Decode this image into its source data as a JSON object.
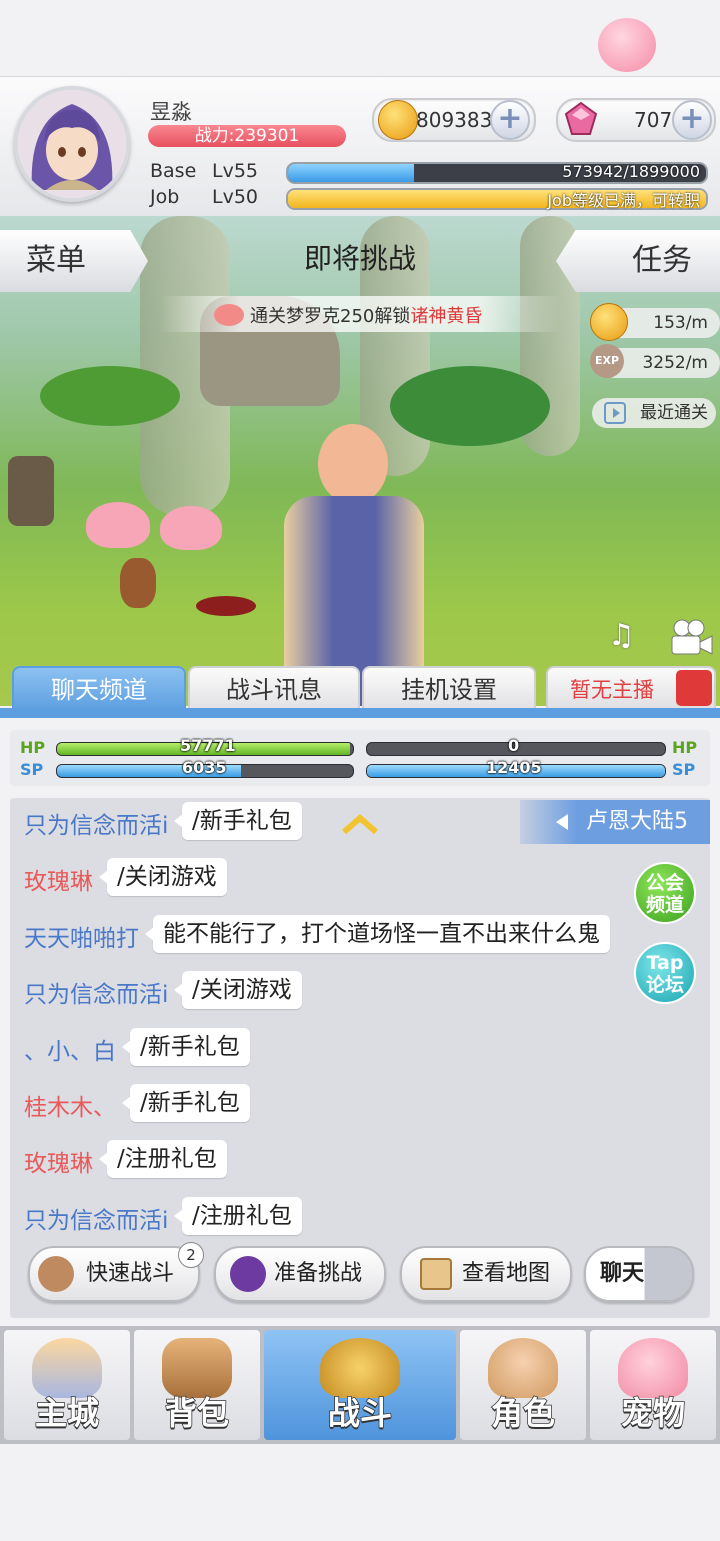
{
  "player": {
    "name": "昱淼",
    "power": "战力:239301"
  },
  "currency": {
    "coins": "809383",
    "gems": "707"
  },
  "levels": {
    "base_label": "Base",
    "base_level": "Lv55",
    "base_exp": "573942/1899000",
    "base_progress": 0.302,
    "job_label": "Job",
    "job_level": "Lv50",
    "job_status": "Job等级已满，可转职",
    "job_progress": 1.0
  },
  "scene": {
    "menu_label": "菜单",
    "task_label": "任务",
    "headline": "即将挑战",
    "unlock_prefix": "通关梦罗克250解锁",
    "unlock_highlight": "诸神黄昏",
    "coin_rate": "153/m",
    "exp_rate": "3252/m",
    "exp_icon": "EXP",
    "recent_clear": "最近通关"
  },
  "tabs": [
    {
      "label": "聊天频道",
      "active": true
    },
    {
      "label": "战斗讯息",
      "active": false
    },
    {
      "label": "挂机设置",
      "active": false
    }
  ],
  "broadcast": "暂无主播",
  "stats": {
    "hp_label": "HP",
    "sp_label": "SP",
    "player_hp": "57771",
    "player_hp_fill": 0.99,
    "player_sp": "6035",
    "player_sp_fill": 0.62,
    "pet_hp": "0",
    "pet_hp_fill": 0,
    "pet_sp": "12405",
    "pet_sp_fill": 1.0
  },
  "chat": {
    "region": "卢恩大陆5",
    "guild_btn": "公会\n频道",
    "tap_btn": "Tap\n论坛",
    "messages": [
      {
        "name": "只为信念而活i",
        "text": "/新手礼包",
        "color": "#4a78c8"
      },
      {
        "name": "玫瑰琳",
        "text": "/关闭游戏",
        "color": "#e85a5a"
      },
      {
        "name": "天天啪啪打",
        "text": "能不能行了，打个道场怪一直不出来什么鬼",
        "color": "#4a78c8"
      },
      {
        "name": "只为信念而活i",
        "text": "/关闭游戏",
        "color": "#4a78c8"
      },
      {
        "name": "、小、白",
        "text": "/新手礼包",
        "color": "#4a78c8"
      },
      {
        "name": "桂木木、",
        "text": "/新手礼包",
        "color": "#e85a5a"
      },
      {
        "name": "玫瑰琳",
        "text": "/注册礼包",
        "color": "#e85a5a"
      },
      {
        "name": "只为信念而活i",
        "text": "/注册礼包",
        "color": "#4a78c8"
      }
    ]
  },
  "actions": {
    "quick_battle": "快速战斗",
    "quick_badge": "2",
    "prepare": "准备挑战",
    "map": "查看地图",
    "chat_toggle": "聊天"
  },
  "nav": [
    {
      "label": "主城",
      "active": false
    },
    {
      "label": "背包",
      "active": false
    },
    {
      "label": "战斗",
      "active": true
    },
    {
      "label": "角色",
      "active": false
    },
    {
      "label": "宠物",
      "active": false
    }
  ]
}
